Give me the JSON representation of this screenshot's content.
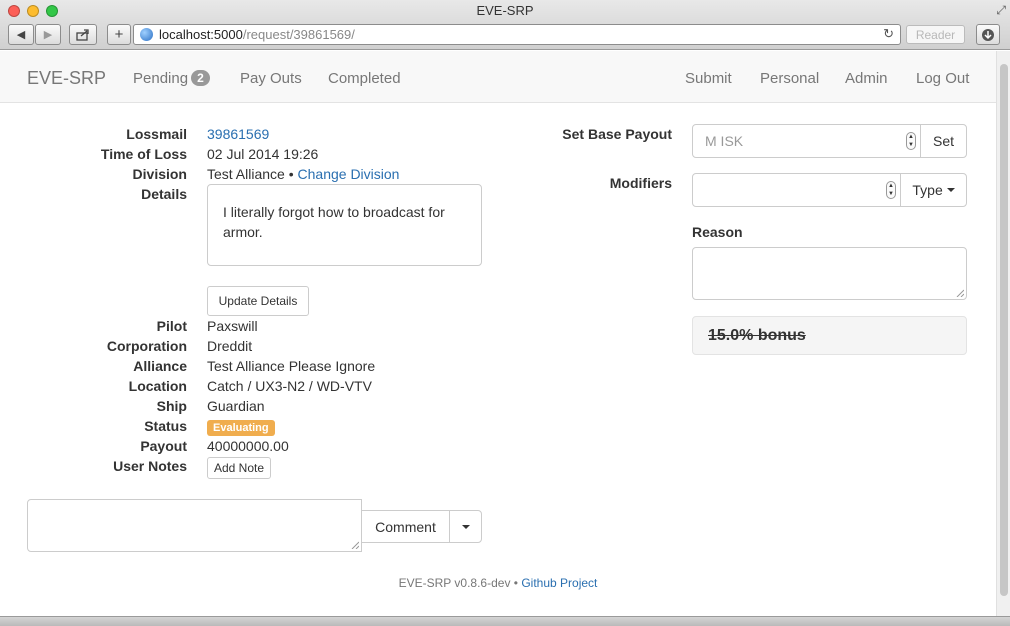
{
  "browser": {
    "window_title": "EVE-SRP",
    "url_host": "localhost:5000",
    "url_path": "/request/39861569/",
    "reader_label": "Reader"
  },
  "nav": {
    "brand": "EVE-SRP",
    "pending_label": "Pending",
    "pending_count": "2",
    "payouts": "Pay Outs",
    "completed": "Completed",
    "submit": "Submit",
    "personal": "Personal",
    "admin": "Admin",
    "logout": "Log Out"
  },
  "request": {
    "labels": {
      "lossmail": "Lossmail",
      "time_of_loss": "Time of Loss",
      "division": "Division",
      "details": "Details",
      "pilot": "Pilot",
      "corporation": "Corporation",
      "alliance": "Alliance",
      "location": "Location",
      "ship": "Ship",
      "status": "Status",
      "payout": "Payout",
      "user_notes": "User Notes"
    },
    "lossmail_id": "39861569",
    "time_of_loss": "02 Jul 2014 19:26",
    "division": "Test Alliance",
    "division_sep": " • ",
    "change_division": "Change Division",
    "details_text": "I literally forgot how to broadcast for armor.",
    "update_details": "Update Details",
    "pilot": "Paxswill",
    "corporation": "Dreddit",
    "alliance": "Test Alliance Please Ignore",
    "location": "Catch / UX3-N2 / WD-VTV",
    "ship": "Guardian",
    "status": "Evaluating",
    "payout": "40000000.00",
    "add_note": "Add Note"
  },
  "comment": {
    "button": "Comment"
  },
  "payout_form": {
    "set_base_label": "Set Base Payout",
    "base_placeholder": "M ISK",
    "set_button": "Set",
    "modifiers_label": "Modifiers",
    "type_button": "Type",
    "reason_label": "Reason",
    "modifier_item": "15.0% bonus"
  },
  "footer": {
    "version": "EVE-SRP v0.8.6-dev",
    "sep": " • ",
    "github": "Github Project"
  },
  "colors": {
    "link": "#2a6fb0",
    "status_evaluating": "#f0ad4e",
    "badge": "#999999"
  }
}
